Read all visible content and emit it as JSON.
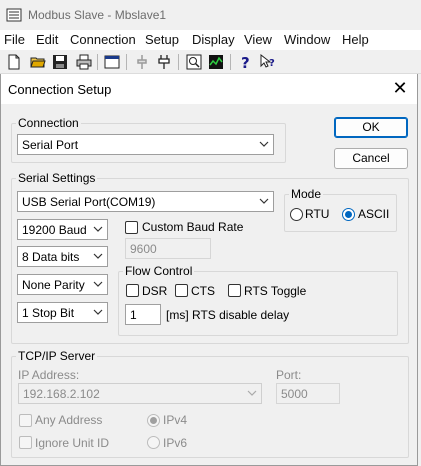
{
  "app": {
    "title": "Modbus Slave - Mbslave1",
    "menu": [
      "File",
      "Edit",
      "Connection",
      "Setup",
      "Display",
      "View",
      "Window",
      "Help"
    ]
  },
  "dialog": {
    "title": "Connection Setup",
    "ok_label": "OK",
    "cancel_label": "Cancel",
    "connection": {
      "legend": "Connection",
      "value": "Serial Port"
    },
    "serial": {
      "legend": "Serial Settings",
      "port": "USB Serial Port(COM19)",
      "baud": "19200 Baud",
      "data_bits": "8 Data bits",
      "parity": "None Parity",
      "stop_bits": "1 Stop Bit",
      "custom_baud_label": "Custom Baud Rate",
      "custom_baud_value": "9600",
      "mode": {
        "legend": "Mode",
        "rtu_label": "RTU",
        "ascii_label": "ASCII",
        "selected": "ASCII"
      },
      "flow": {
        "legend": "Flow Control",
        "dsr_label": "DSR",
        "cts_label": "CTS",
        "rts_toggle_label": "RTS Toggle",
        "delay_value": "1",
        "delay_label": "[ms] RTS disable delay"
      }
    },
    "tcp": {
      "legend": "TCP/IP Server",
      "ip_label": "IP Address:",
      "ip_value": "192.168.2.102",
      "port_label": "Port:",
      "port_value": "5000",
      "any_address_label": "Any Address",
      "ignore_unit_label": "Ignore Unit ID",
      "ipv4_label": "IPv4",
      "ipv6_label": "IPv6"
    }
  }
}
